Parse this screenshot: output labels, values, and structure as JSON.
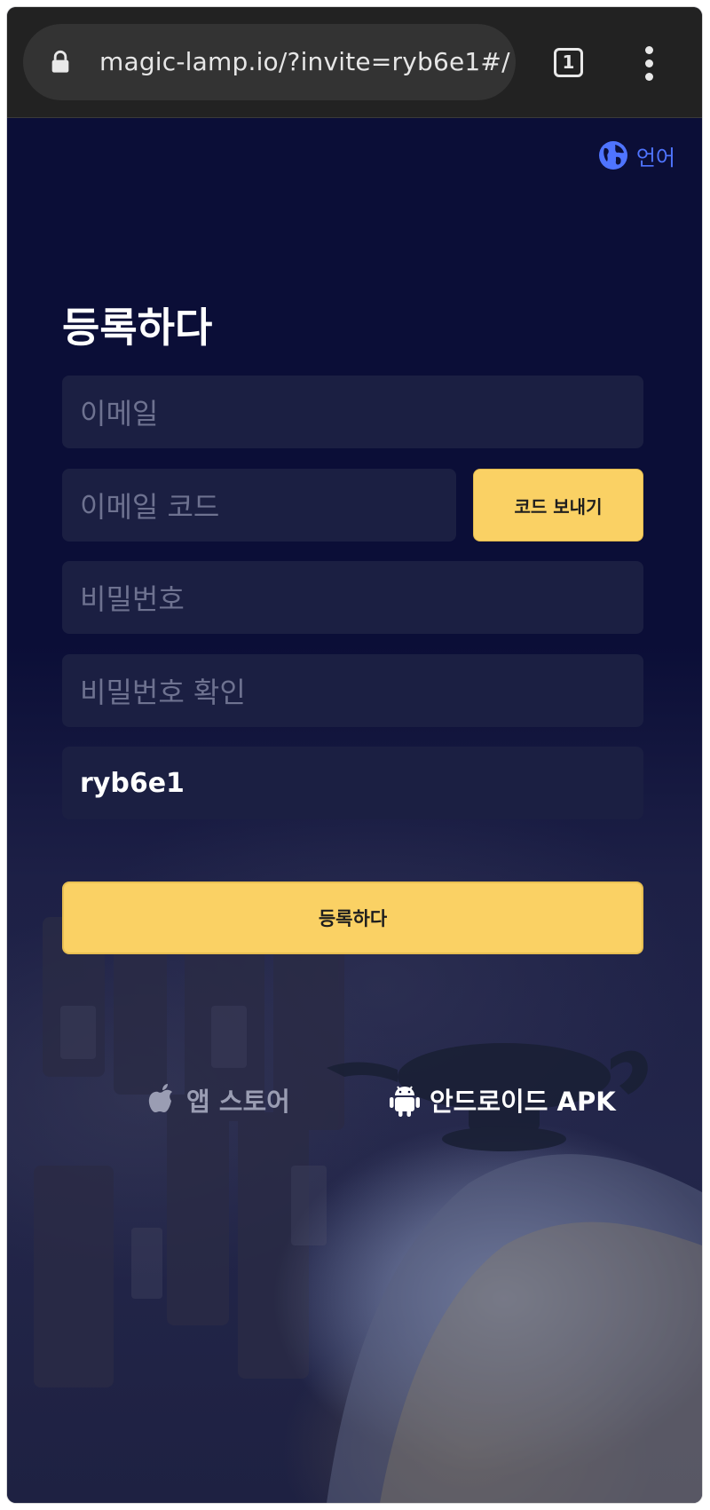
{
  "browser": {
    "url": "magic-lamp.io/?invite=ryb6e1#/",
    "tab_count": "1",
    "icons": {
      "lock": "lock-icon",
      "tabs": "tab-switcher-icon",
      "menu": "more-vert-icon"
    }
  },
  "header": {
    "language_label": "언어",
    "language_icon": "globe-icon"
  },
  "form": {
    "title": "등록하다",
    "email_placeholder": "이메일",
    "email_code_placeholder": "이메일 코드",
    "send_code_label": "코드 보내기",
    "password_placeholder": "비밀번호",
    "confirm_password_placeholder": "비밀번호 확인",
    "invite_code_value": "ryb6e1",
    "submit_label": "등록하다"
  },
  "downloads": {
    "app_store_label": "앱 스토어",
    "app_store_icon": "apple-icon",
    "android_label": "안드로이드 APK",
    "android_icon": "android-icon"
  },
  "colors": {
    "background": "#0a0e35",
    "field_background": "#1b1f42",
    "accent_button": "#fad164",
    "link_blue": "#4f74ff"
  }
}
